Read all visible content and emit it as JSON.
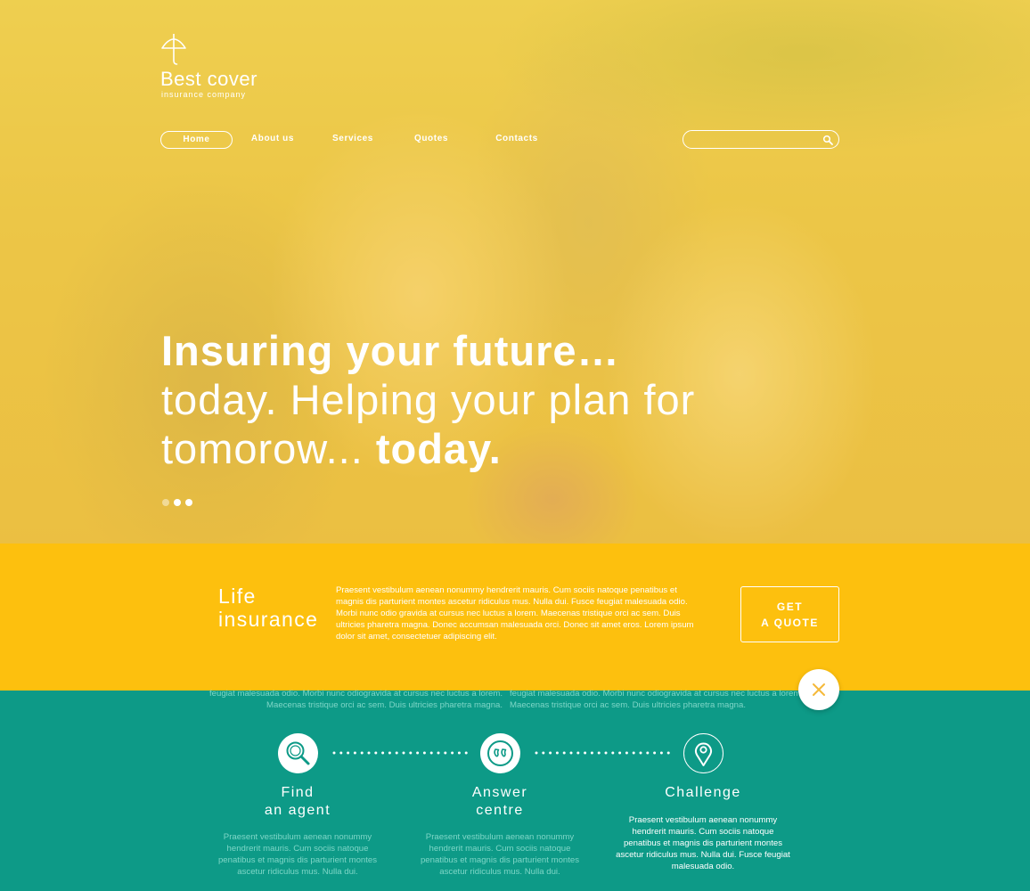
{
  "brand": {
    "name": "Best cover",
    "tagline": "insurance company"
  },
  "nav": {
    "items": [
      {
        "label": "Home",
        "active": true
      },
      {
        "label": "About us",
        "active": false
      },
      {
        "label": "Services",
        "active": false
      },
      {
        "label": "Quotes",
        "active": false
      },
      {
        "label": "Contacts",
        "active": false
      }
    ]
  },
  "search": {
    "placeholder": "",
    "icon": "search-icon"
  },
  "hero": {
    "line1": "Insuring your future…",
    "line2": "today. Helping your plan for",
    "line3_regular": "tomorow... ",
    "line3_bold": "today.",
    "slides": [
      {
        "active": false
      },
      {
        "active": true
      },
      {
        "active": true
      }
    ]
  },
  "life": {
    "title": "Life insurance",
    "body": "Praesent vestibulum aenean nonummy hendrerit mauris. Cum sociis natoque penatibus et magnis dis parturient montes ascetur ridiculus mus. Nulla dui. Fusce feugiat malesuada odio. Morbi nunc odio gravida at cursus nec luctus a lorem. Maecenas tristique orci ac sem. Duis ultricies pharetra magna. Donec accumsan malesuada orci. Donec sit amet eros. Lorem ipsum dolor sit amet, consectetuer adipiscing elit.",
    "cta_line1": "GET",
    "cta_line2": "A QUOTE"
  },
  "peek": {
    "left_line1": "feugiat malesuada odio. Morbi nunc odiogravida at cursus nec luctus a lorem.",
    "left_line2": "Maecenas tristique orci ac sem. Duis ultricies pharetra magna.",
    "right_line1": "feugiat malesuada odio. Morbi nunc odiogravida at cursus nec luctus a lorem.",
    "right_line2": "Maecenas tristique orci ac sem. Duis ultricies pharetra magna."
  },
  "steps": [
    {
      "title_line1": "Find",
      "title_line2": "an agent",
      "icon": "magnifier-icon",
      "text": "Praesent vestibulum aenean nonummy hendrerit mauris. Cum sociis natoque penatibus et magnis dis parturient montes ascetur ridiculus mus. Nulla dui."
    },
    {
      "title_line1": "Answer",
      "title_line2": "centre",
      "icon": "quote-icon",
      "text": "Praesent vestibulum aenean nonummy hendrerit mauris. Cum sociis natoque penatibus et magnis dis parturient montes ascetur ridiculus mus. Nulla dui."
    },
    {
      "title_line1": "Challenge",
      "title_line2": "",
      "icon": "map-pin-icon",
      "text": "Praesent vestibulum aenean nonummy hendrerit mauris. Cum sociis natoque penatibus et magnis dis parturient montes ascetur ridiculus mus. Nulla dui. Fusce feugiat malesuada odio."
    }
  ],
  "colors": {
    "hero_overlay": "#fac83c",
    "life_band": "#fdc00e",
    "teal": "#0d9a87",
    "faded_text": "#7ed6c7",
    "close_x": "#f5b93a"
  }
}
